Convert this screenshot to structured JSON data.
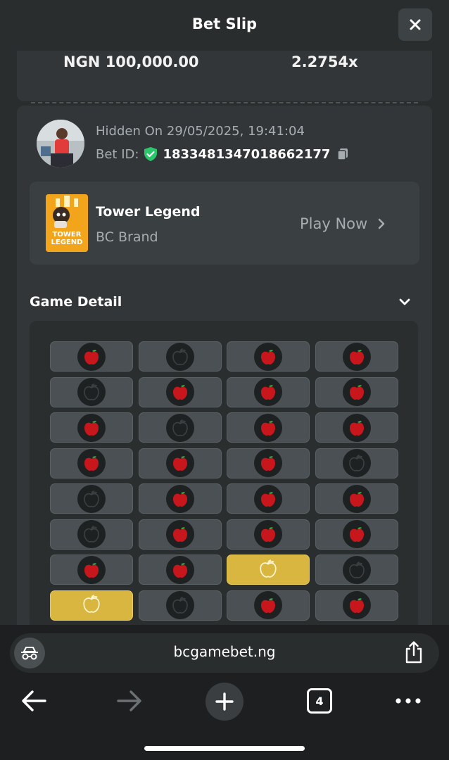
{
  "header": {
    "title": "Bet Slip"
  },
  "stake": {
    "amount": "NGN 100,000.00",
    "multiplier": "2.2754x"
  },
  "bet": {
    "hidden_on": "Hidden On 29/05/2025, 19:41:04",
    "bet_id_label": "Bet ID:",
    "bet_id": "1833481347018662177"
  },
  "game": {
    "name": "Tower Legend",
    "provider": "BC Brand",
    "thumb_text_line1": "TOWER",
    "thumb_text_line2": "LEGEND",
    "play_label": "Play Now"
  },
  "game_detail": {
    "title": "Game Detail",
    "rows": [
      [
        "apple",
        "dark",
        "apple",
        "apple"
      ],
      [
        "dark",
        "apple",
        "apple",
        "apple"
      ],
      [
        "apple",
        "dark",
        "apple",
        "apple"
      ],
      [
        "apple",
        "apple",
        "apple",
        "dark"
      ],
      [
        "dark",
        "apple",
        "apple",
        "apple"
      ],
      [
        "dark",
        "apple",
        "apple",
        "apple"
      ],
      [
        "apple",
        "apple",
        "gold",
        "dark"
      ],
      [
        "gold",
        "dark",
        "apple",
        "apple"
      ]
    ]
  },
  "browser": {
    "url": "bcgamebet.ng",
    "tab_count": "4"
  },
  "colors": {
    "apple_red": "#c8161d",
    "gold_cell": "#d9b640",
    "shield_green": "#2bc86b"
  }
}
